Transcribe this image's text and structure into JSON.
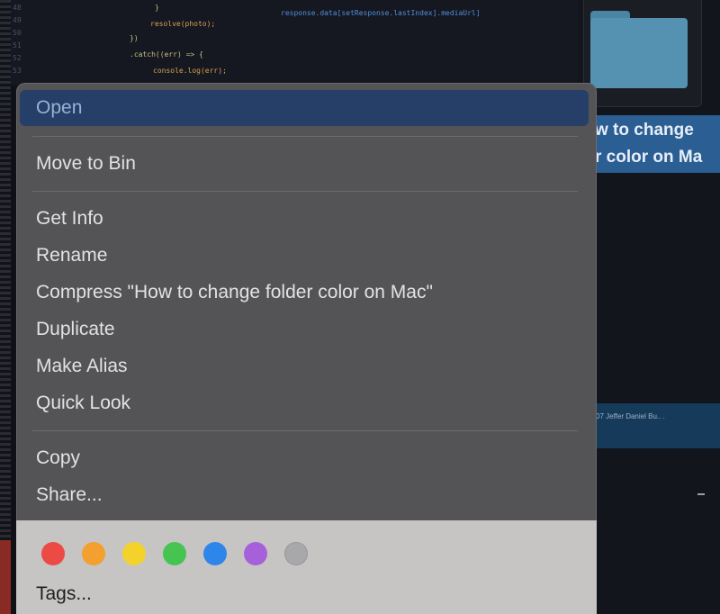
{
  "code": {
    "lines": [
      "}",
      "resolve(photo);",
      "})",
      ".catch((err) => {",
      "console.log(err);"
    ],
    "fragment": "response.data[setResponse.lastIndex].mediaUrl]"
  },
  "finder": {
    "folder_label_line1": "w to change",
    "folder_label_line2": "r color on Ma",
    "bar_text": "07  Jeffer Daniel  Bu.. ."
  },
  "context_menu": {
    "open": "Open",
    "move_to_bin": "Move to Bin",
    "get_info": "Get Info",
    "rename": "Rename",
    "compress": "Compress \"How to change folder color on Mac\"",
    "duplicate": "Duplicate",
    "make_alias": "Make Alias",
    "quick_look": "Quick Look",
    "copy": "Copy",
    "share": "Share...",
    "tags": "Tags...",
    "tag_colors": [
      {
        "name": "red-tag",
        "color": "#ec4a45"
      },
      {
        "name": "orange-tag",
        "color": "#f3a02e"
      },
      {
        "name": "yellow-tag",
        "color": "#f3d22c"
      },
      {
        "name": "green-tag",
        "color": "#46c451"
      },
      {
        "name": "blue-tag",
        "color": "#2f86ea"
      },
      {
        "name": "purple-tag",
        "color": "#a660d9"
      },
      {
        "name": "gray-tag",
        "color": "#a8a8ab"
      }
    ]
  }
}
